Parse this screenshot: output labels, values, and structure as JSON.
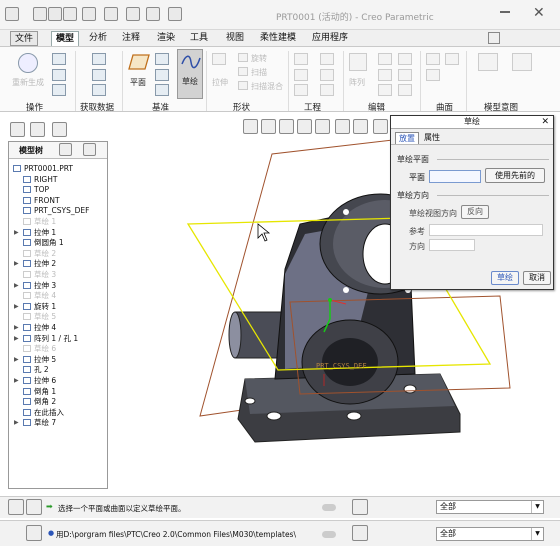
{
  "window": {
    "title": "PRT0001 (活动的) - Creo Parametric"
  },
  "ribbon_tabs": [
    {
      "label": "文件",
      "active": false
    },
    {
      "label": "模型",
      "active": true
    },
    {
      "label": "分析",
      "active": false
    },
    {
      "label": "注释",
      "active": false
    },
    {
      "label": "渲染",
      "active": false
    },
    {
      "label": "工具",
      "active": false
    },
    {
      "label": "视图",
      "active": false
    },
    {
      "label": "柔性建模",
      "active": false
    },
    {
      "label": "应用程序",
      "active": false
    }
  ],
  "ribbon": {
    "regen_label": "重新生成",
    "plane_label": "平面",
    "sketch_label": "草绘",
    "extrude_label": "拉伸",
    "revolve_label": "旋转",
    "sweep_label": "扫描",
    "sweep_blend_label": "扫描混合",
    "hole_label": "孔",
    "pattern_label": "阵列",
    "groups": [
      "操作",
      "获取数据",
      "基准",
      "形状",
      "工程",
      "编辑",
      "曲面",
      "模型意图"
    ]
  },
  "model_tree": {
    "header": "模型树",
    "items": [
      {
        "label": "PRT0001.PRT",
        "grey": false,
        "expand": false
      },
      {
        "label": "RIGHT",
        "grey": false,
        "expand": false
      },
      {
        "label": "TOP",
        "grey": false,
        "expand": false
      },
      {
        "label": "FRONT",
        "grey": false,
        "expand": false
      },
      {
        "label": "PRT_CSYS_DEF",
        "grey": false,
        "expand": false
      },
      {
        "label": "草绘 1",
        "grey": true,
        "expand": false
      },
      {
        "label": "拉伸 1",
        "grey": false,
        "expand": true
      },
      {
        "label": "倒圆角 1",
        "grey": false,
        "expand": false
      },
      {
        "label": "草绘 2",
        "grey": true,
        "expand": false
      },
      {
        "label": "拉伸 2",
        "grey": false,
        "expand": true
      },
      {
        "label": "草绘 3",
        "grey": true,
        "expand": false
      },
      {
        "label": "拉伸 3",
        "grey": false,
        "expand": true
      },
      {
        "label": "草绘 4",
        "grey": true,
        "expand": false
      },
      {
        "label": "旋转 1",
        "grey": false,
        "expand": true
      },
      {
        "label": "草绘 5",
        "grey": true,
        "expand": false
      },
      {
        "label": "拉伸 4",
        "grey": false,
        "expand": true
      },
      {
        "label": "阵列 1 / 孔 1",
        "grey": false,
        "expand": true
      },
      {
        "label": "草绘 6",
        "grey": true,
        "expand": false
      },
      {
        "label": "拉伸 5",
        "grey": false,
        "expand": true
      },
      {
        "label": "孔 2",
        "grey": false,
        "expand": false
      },
      {
        "label": "拉伸 6",
        "grey": false,
        "expand": true
      },
      {
        "label": "倒角 1",
        "grey": false,
        "expand": false
      },
      {
        "label": "倒角 2",
        "grey": false,
        "expand": false
      },
      {
        "label": "在此插入",
        "grey": false,
        "expand": false
      },
      {
        "label": "草绘 7",
        "grey": false,
        "expand": true
      }
    ]
  },
  "viewport": {
    "csys_label": "PRT_CSYS_DEF"
  },
  "dialog": {
    "title": "草绘",
    "tabs": [
      "放置",
      "属性"
    ],
    "section_plane": "草绘平面",
    "plane_label": "平面",
    "use_previous_button": "使用先前的",
    "section_orientation": "草绘方向",
    "view_direction_label": "草绘视图方向",
    "reverse_button": "反向",
    "reference_label": "参考",
    "direction_label": "方向",
    "sketch_button": "草绘",
    "cancel_button": "取消"
  },
  "status": {
    "message": "选择一个平面或曲面以定义草绘平面。",
    "path": "用D:\\porgram files\\PTC\\Creo 2.0\\Common Files\\M030\\templates\\",
    "filter_value": "全部"
  },
  "colors": {
    "accent_blue": "#2b55b8",
    "model_dark": "#3a3a3e",
    "datum_plane_orange": "#a0522d",
    "selected_plane_yellow": "#e6e600"
  }
}
